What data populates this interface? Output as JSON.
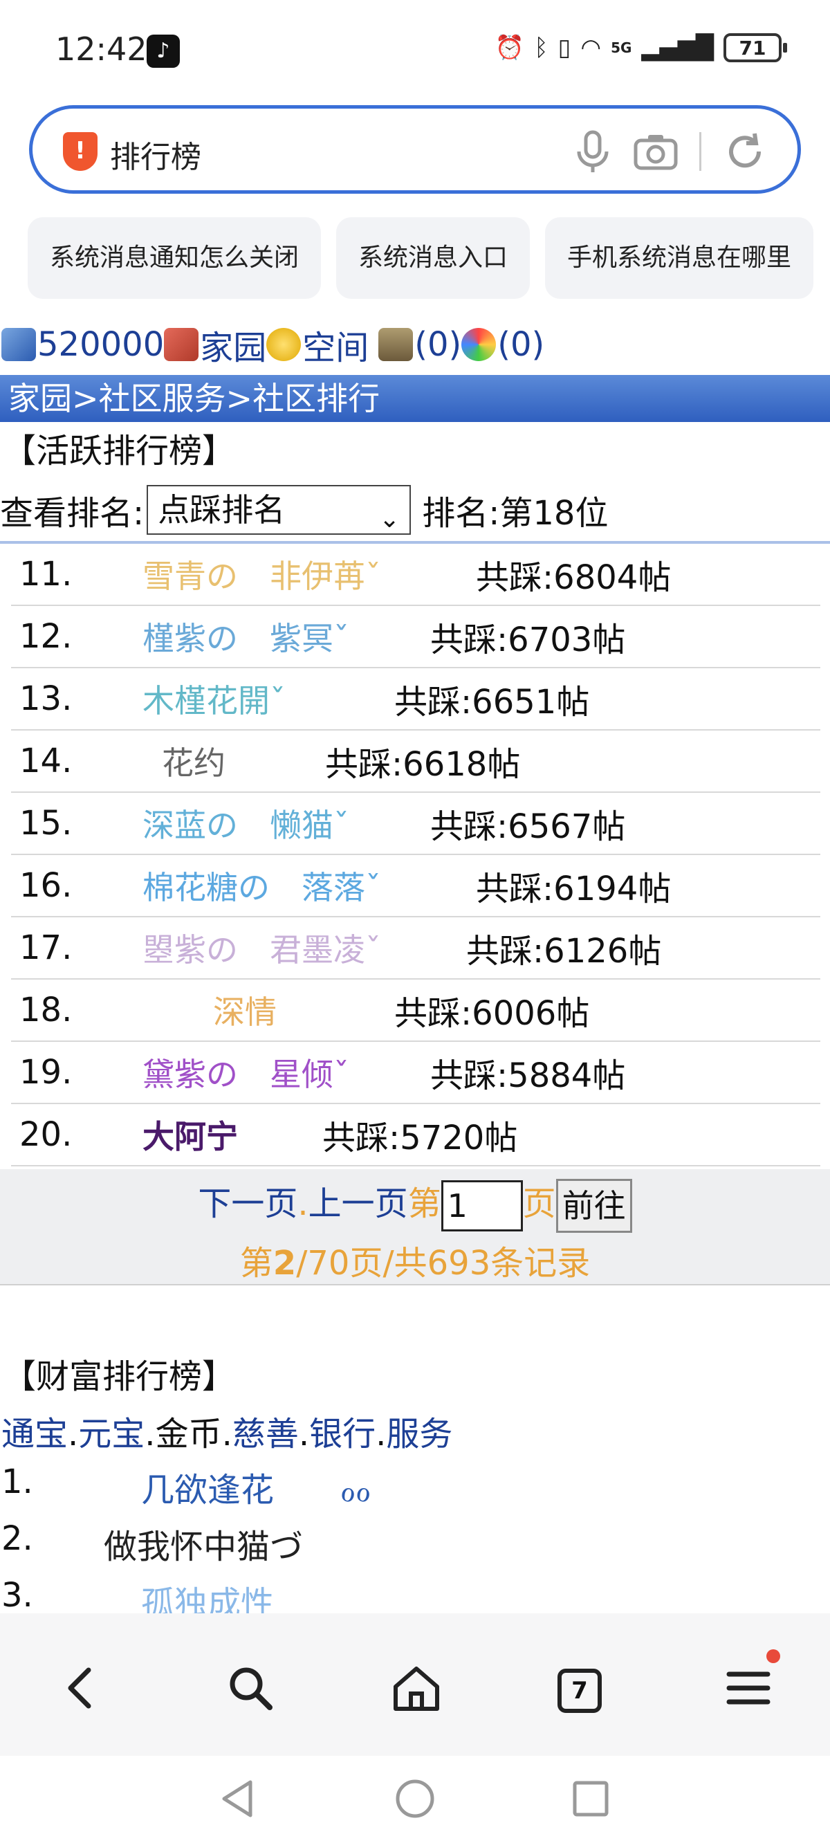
{
  "status_bar": {
    "time": "12:42",
    "battery": "71",
    "network": "5G"
  },
  "search": {
    "query": "排行榜"
  },
  "suggestions": [
    "系统消息通知怎么关闭",
    "系统消息入口",
    "手机系统消息在哪里"
  ],
  "userbar": {
    "id": "520000",
    "home": "家园",
    "space": "空间",
    "bank": "(0)",
    "msg": "(0)"
  },
  "breadcrumb": "家园>社区服务>社区排行",
  "active": {
    "title": "【活跃排行榜】",
    "view_label": "查看排名:",
    "select_value": "点踩排名",
    "rank_text": "排名:第18位",
    "items": [
      {
        "num": "11.",
        "name": "雪青の　非伊苒ˇ",
        "count": "共踩:6804帖"
      },
      {
        "num": "12.",
        "name": "槿紫の　紫冥ˇ",
        "count": "共踩:6703帖"
      },
      {
        "num": "13.",
        "name": "木槿花開ˇ",
        "count": "共踩:6651帖"
      },
      {
        "num": "14.",
        "name": "花约",
        "count": "共踩:6618帖"
      },
      {
        "num": "15.",
        "name": "深蓝の　懒猫ˇ",
        "count": "共踩:6567帖"
      },
      {
        "num": "16.",
        "name": "棉花糖の　落落ˇ",
        "count": "共踩:6194帖"
      },
      {
        "num": "17.",
        "name": "曌紫の　君墨凌ˇ",
        "count": "共踩:6126帖"
      },
      {
        "num": "18.",
        "name": "深情",
        "count": "共踩:6006帖"
      },
      {
        "num": "19.",
        "name": "黛紫の　星倾ˇ",
        "count": "共踩:5884帖"
      },
      {
        "num": "20.",
        "name": "大阿宁",
        "count": "共踩:5720帖"
      }
    ]
  },
  "pager": {
    "next": "下一页",
    "dot": ".",
    "prev": "上一页",
    "di": "第",
    "page_value": "1",
    "ye": "页",
    "go": "前往",
    "summary_pre": "第",
    "current": "2",
    "summary_post": "/70页/共693条记录"
  },
  "wealth": {
    "title": "【财富排行榜】",
    "links": [
      "通宝",
      "元宝",
      "金币",
      "慈善",
      "银行",
      "服务"
    ],
    "items": [
      {
        "num": "1.",
        "name": "几欲逢花　　ℴℴ"
      },
      {
        "num": "2.",
        "name": "做我怀中猫づ"
      },
      {
        "num": "3.",
        "name": "孤独成性"
      }
    ]
  },
  "bottom_nav": {
    "tabs_count": "7"
  },
  "colors": {
    "accent": "#3a6fd8",
    "link": "#1d3f95",
    "orange": "#e8a33a",
    "header_bar": "#2f5fbf"
  }
}
